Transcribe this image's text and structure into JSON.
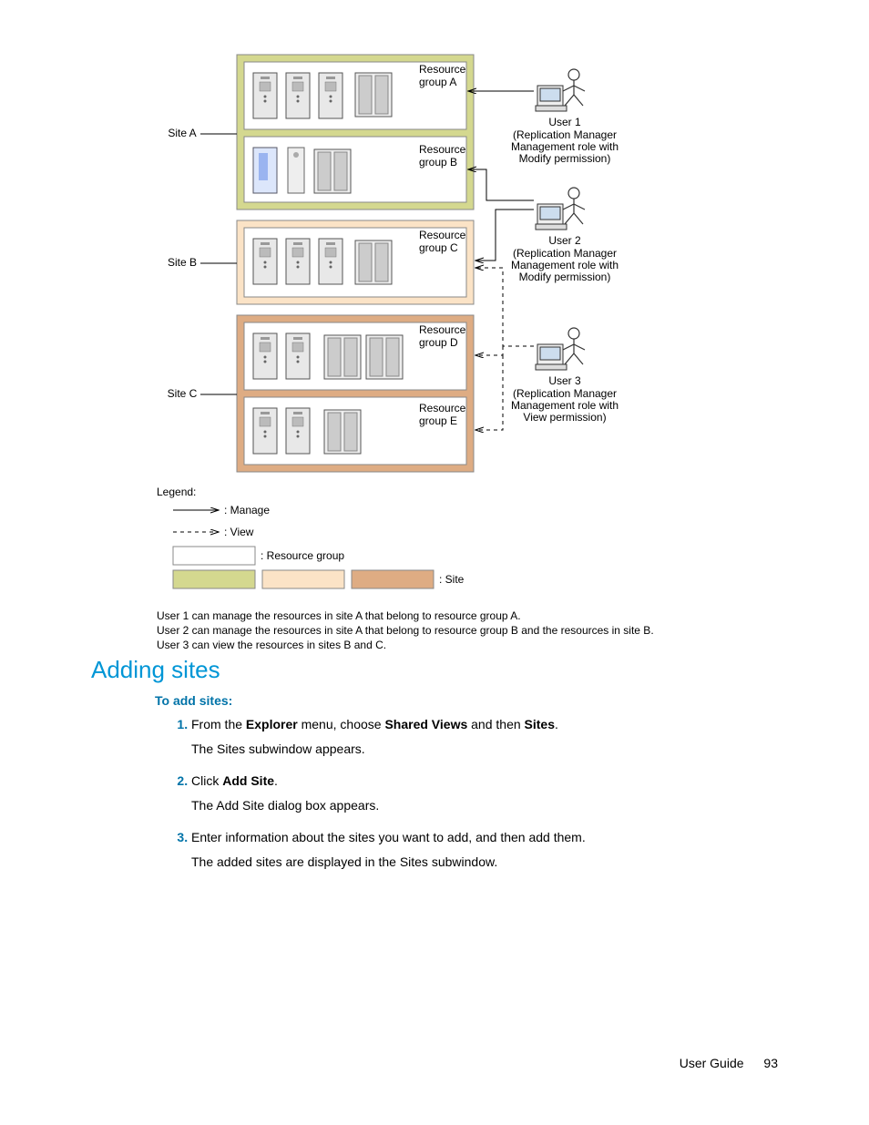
{
  "diagram": {
    "sites": {
      "a": "Site A",
      "b": "Site B",
      "c": "Site C"
    },
    "resource_groups": {
      "a": "Resource\ngroup A",
      "b": "Resource\ngroup B",
      "c": "Resource\ngroup C",
      "d": "Resource\ngroup D",
      "e": "Resource\ngroup E"
    },
    "users": {
      "u1_name": "User 1",
      "u1_desc": "(Replication Manager\nManagement role with\nModify permission)",
      "u2_name": "User 2",
      "u2_desc": "(Replication Manager\nManagement role with\nModify permission)",
      "u3_name": "User 3",
      "u3_desc": "(Replication Manager\nManagement role with\nView permission)"
    },
    "legend": {
      "title": "Legend:",
      "manage": ": Manage",
      "view": ": View",
      "rg": ": Resource group",
      "site": ": Site"
    },
    "notes": {
      "n1": "User 1 can manage the resources in site A that belong to resource group A.",
      "n2": "User 2 can manage the resources in site A that belong to resource group B and the resources in site B.",
      "n3": "User 3 can view the resources in sites B and C."
    }
  },
  "section": {
    "heading": "Adding sites",
    "subheading": "To add sites:",
    "steps": {
      "s1_a": "From the ",
      "s1_b": "Explorer",
      "s1_c": " menu, choose ",
      "s1_d": "Shared Views",
      "s1_e": " and then ",
      "s1_f": "Sites",
      "s1_g": ".",
      "s1_sub": "The Sites subwindow appears.",
      "s2_a": "Click ",
      "s2_b": "Add Site",
      "s2_c": ".",
      "s2_sub": "The Add Site dialog box appears.",
      "s3": "Enter information about the sites you want to add, and then add them.",
      "s3_sub": "The added sites are displayed in the Sites subwindow."
    }
  },
  "footer": {
    "label": "User Guide",
    "page": "93"
  }
}
